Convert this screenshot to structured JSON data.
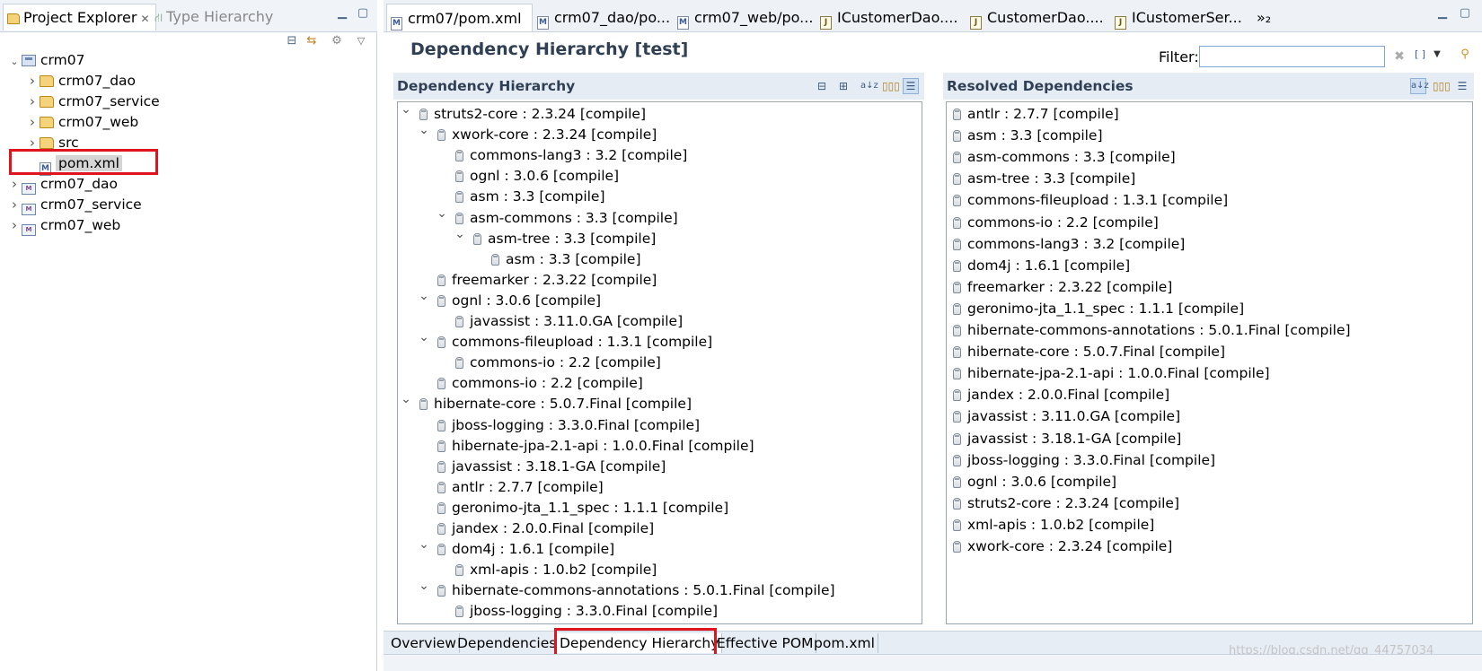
{
  "left_panel": {
    "tabs": [
      {
        "label": "Project Explorer"
      },
      {
        "label": "Type Hierarchy"
      }
    ],
    "tree": [
      {
        "label": "crm07",
        "depth": 0,
        "expanded": true,
        "icon": "project-folder-icon"
      },
      {
        "label": "crm07_dao",
        "depth": 1,
        "expanded": false,
        "icon": "folder-icon"
      },
      {
        "label": "crm07_service",
        "depth": 1,
        "expanded": false,
        "icon": "folder-icon"
      },
      {
        "label": "crm07_web",
        "depth": 1,
        "expanded": false,
        "icon": "folder-icon"
      },
      {
        "label": "src",
        "depth": 1,
        "expanded": false,
        "icon": "folder-icon"
      },
      {
        "label": "pom.xml",
        "depth": 1,
        "icon": "maven-xml-icon",
        "selected": true
      },
      {
        "label": "crm07_dao",
        "depth": 0,
        "expanded": false,
        "icon": "maven-project-icon"
      },
      {
        "label": "crm07_service",
        "depth": 0,
        "expanded": false,
        "icon": "maven-project-icon"
      },
      {
        "label": "crm07_web",
        "depth": 0,
        "expanded": false,
        "icon": "maven-project-icon"
      }
    ]
  },
  "editor_tabs": [
    {
      "label": "crm07/pom.xml",
      "icon": "maven-xml-icon",
      "active": true
    },
    {
      "label": "crm07_dao/po...",
      "icon": "maven-xml-icon"
    },
    {
      "label": "crm07_web/po...",
      "icon": "maven-xml-icon"
    },
    {
      "label": "ICustomerDao....",
      "icon": "java-interface-icon"
    },
    {
      "label": "CustomerDao....",
      "icon": "java-class-icon"
    },
    {
      "label": "ICustomerSer...",
      "icon": "java-interface-icon"
    },
    {
      "label": "»₂",
      "icon": "overflow-icon"
    }
  ],
  "editor": {
    "title": "Dependency Hierarchy [test]",
    "filter_label": "Filter:",
    "filter_value": ""
  },
  "hierarchy": {
    "title": "Dependency Hierarchy",
    "rows": [
      {
        "text": "struts2-core : 2.3.24 [compile]",
        "depth": 0,
        "twisty": "open"
      },
      {
        "text": "xwork-core : 2.3.24 [compile]",
        "depth": 1,
        "twisty": "open"
      },
      {
        "text": "commons-lang3 : 3.2 [compile]",
        "depth": 2
      },
      {
        "text": "ognl : 3.0.6 [compile]",
        "depth": 2
      },
      {
        "text": "asm : 3.3 [compile]",
        "depth": 2
      },
      {
        "text": "asm-commons : 3.3 [compile]",
        "depth": 2,
        "twisty": "open"
      },
      {
        "text": "asm-tree : 3.3 [compile]",
        "depth": 3,
        "twisty": "open"
      },
      {
        "text": "asm : 3.3 [compile]",
        "depth": 4
      },
      {
        "text": "freemarker : 2.3.22 [compile]",
        "depth": 1
      },
      {
        "text": "ognl : 3.0.6 [compile]",
        "depth": 1,
        "twisty": "open"
      },
      {
        "text": "javassist : 3.11.0.GA [compile]",
        "depth": 2
      },
      {
        "text": "commons-fileupload : 1.3.1 [compile]",
        "depth": 1,
        "twisty": "open"
      },
      {
        "text": "commons-io : 2.2 [compile]",
        "depth": 2
      },
      {
        "text": "commons-io : 2.2 [compile]",
        "depth": 1
      },
      {
        "text": "hibernate-core : 5.0.7.Final [compile]",
        "depth": 0,
        "twisty": "open"
      },
      {
        "text": "jboss-logging : 3.3.0.Final [compile]",
        "depth": 1
      },
      {
        "text": "hibernate-jpa-2.1-api : 1.0.0.Final [compile]",
        "depth": 1
      },
      {
        "text": "javassist : 3.18.1-GA [compile]",
        "depth": 1
      },
      {
        "text": "antlr : 2.7.7 [compile]",
        "depth": 1
      },
      {
        "text": "geronimo-jta_1.1_spec : 1.1.1 [compile]",
        "depth": 1
      },
      {
        "text": "jandex : 2.0.0.Final [compile]",
        "depth": 1
      },
      {
        "text": "dom4j : 1.6.1 [compile]",
        "depth": 1,
        "twisty": "open"
      },
      {
        "text": "xml-apis : 1.0.b2 [compile]",
        "depth": 2
      },
      {
        "text": "hibernate-commons-annotations : 5.0.1.Final [compile]",
        "depth": 1,
        "twisty": "open"
      },
      {
        "text": "jboss-logging : 3.3.0.Final [compile]",
        "depth": 2
      }
    ]
  },
  "resolved": {
    "title": "Resolved Dependencies",
    "rows": [
      "antlr : 2.7.7 [compile]",
      "asm : 3.3 [compile]",
      "asm-commons : 3.3 [compile]",
      "asm-tree : 3.3 [compile]",
      "commons-fileupload : 1.3.1 [compile]",
      "commons-io : 2.2 [compile]",
      "commons-lang3 : 3.2 [compile]",
      "dom4j : 1.6.1 [compile]",
      "freemarker : 2.3.22 [compile]",
      "geronimo-jta_1.1_spec : 1.1.1 [compile]",
      "hibernate-commons-annotations : 5.0.1.Final [compile]",
      "hibernate-core : 5.0.7.Final [compile]",
      "hibernate-jpa-2.1-api : 1.0.0.Final [compile]",
      "jandex : 2.0.0.Final [compile]",
      "javassist : 3.11.0.GA [compile]",
      "javassist : 3.18.1-GA [compile]",
      "jboss-logging : 3.3.0.Final [compile]",
      "ognl : 3.0.6 [compile]",
      "struts2-core : 2.3.24 [compile]",
      "xml-apis : 1.0.b2 [compile]",
      "xwork-core : 2.3.24 [compile]"
    ]
  },
  "page_tabs": [
    {
      "label": "Overview"
    },
    {
      "label": "Dependencies"
    },
    {
      "label": "Dependency Hierarchy",
      "active": true
    },
    {
      "label": "Effective POM"
    },
    {
      "label": "pom.xml"
    }
  ],
  "watermark": "https://blog.csdn.net/qq_44757034",
  "colors": {
    "highlight_box": "#e0141e",
    "section_header_bg": "#e6ecf4",
    "title_text": "#2f3f55"
  }
}
